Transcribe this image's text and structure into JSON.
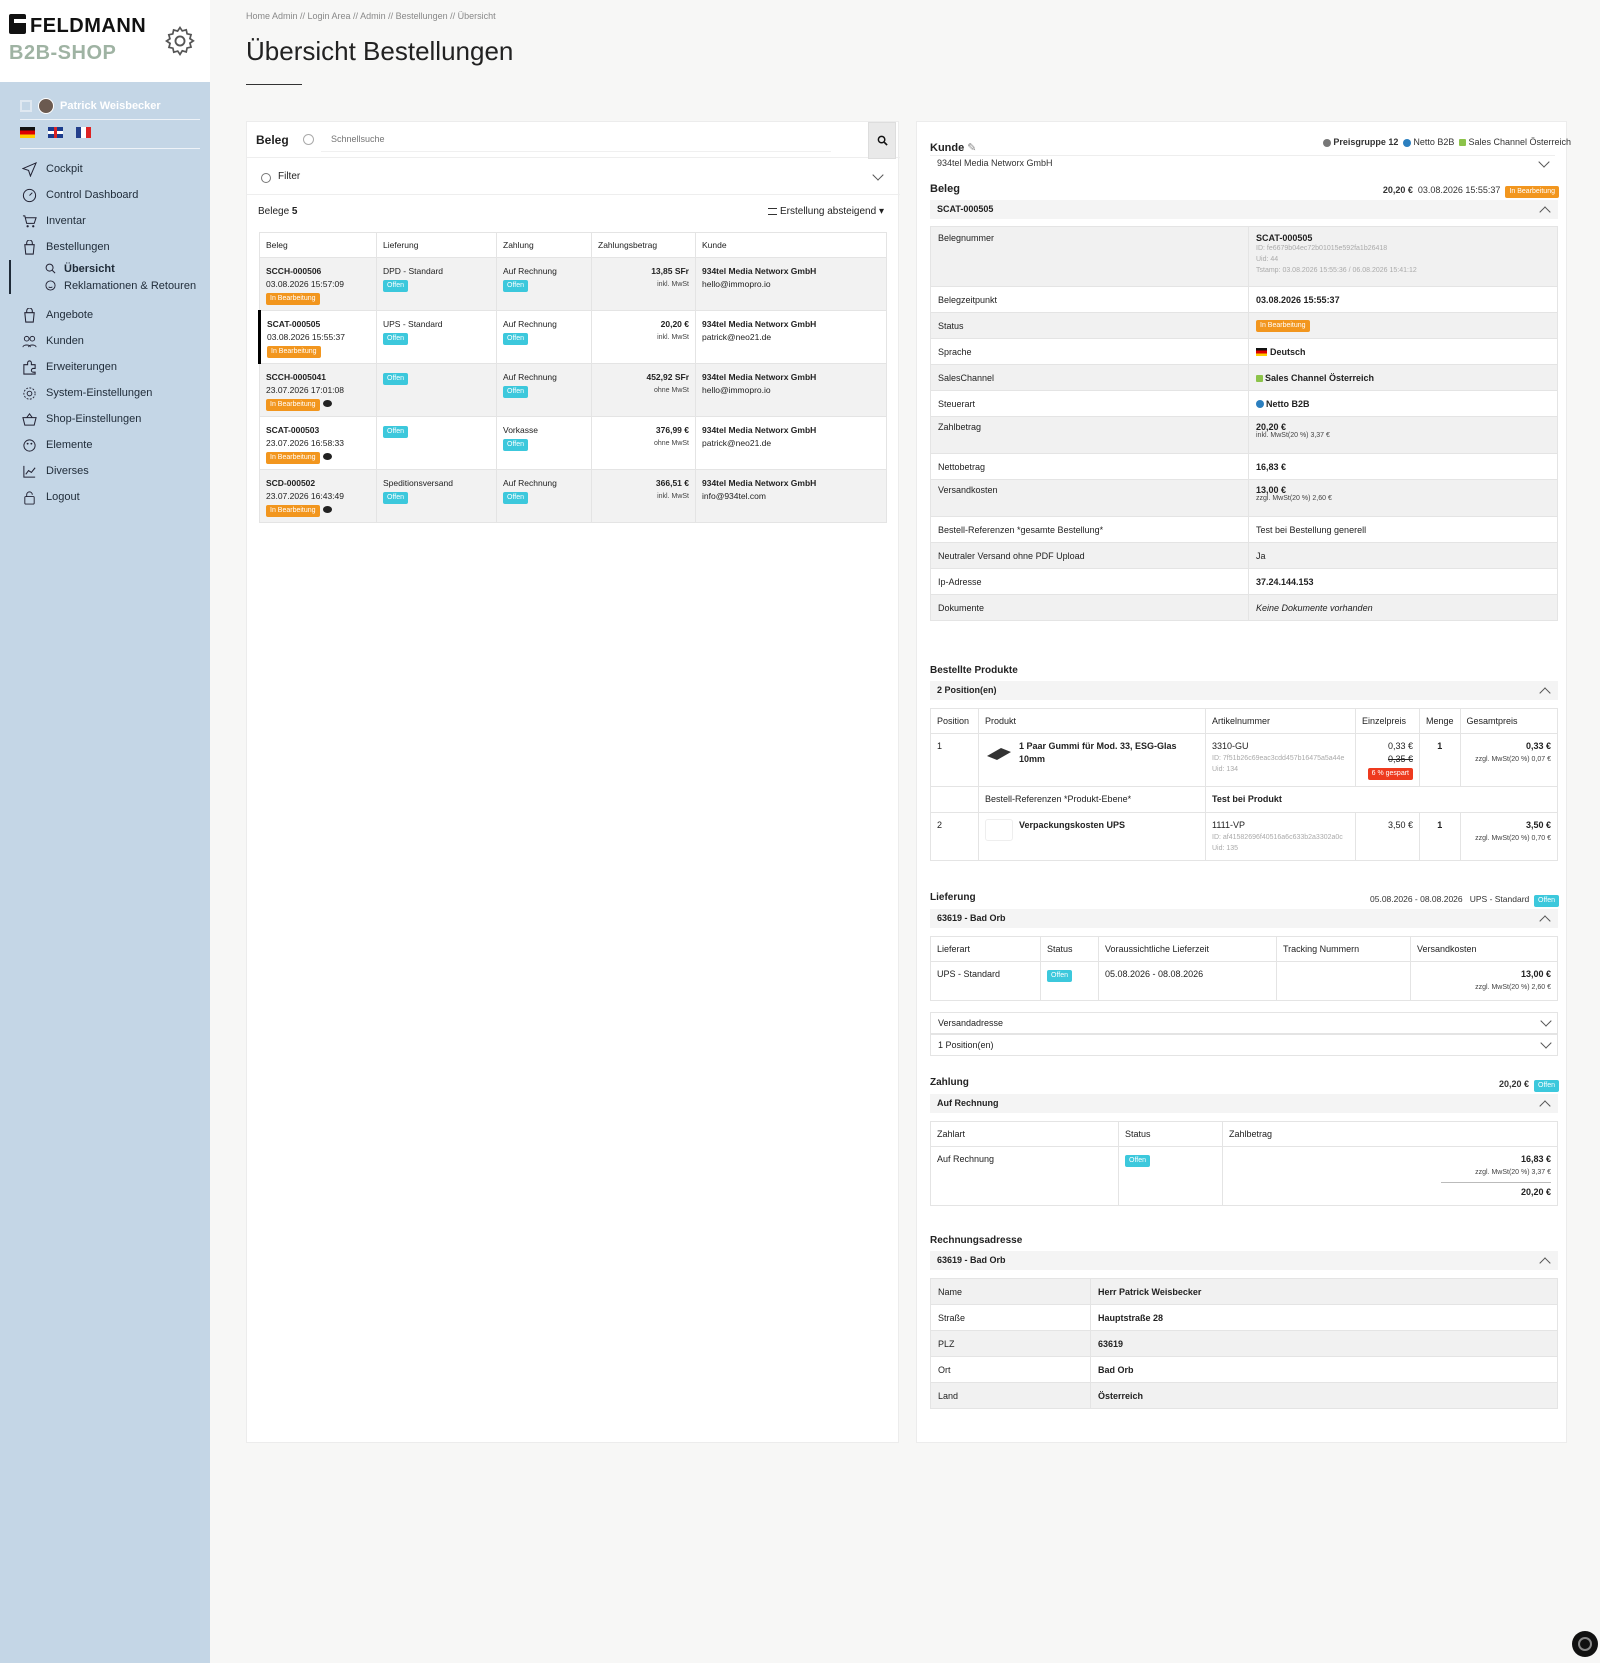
{
  "brand": {
    "line1": "FELDMANN",
    "line2": "B2B-SHOP"
  },
  "user": {
    "name": "Patrick Weisbecker"
  },
  "nav": [
    {
      "label": "Cockpit",
      "icon": "send-icon"
    },
    {
      "label": "Control Dashboard",
      "icon": "dashboard-icon"
    },
    {
      "label": "Inventar",
      "icon": "cart-icon"
    },
    {
      "label": "Bestellungen",
      "icon": "bag-icon"
    },
    {
      "label": "Übersicht",
      "icon": "search-icon"
    },
    {
      "label": "Reklamationen & Retouren",
      "icon": "smile-icon"
    },
    {
      "label": "Angebote",
      "icon": "bag-icon"
    },
    {
      "label": "Kunden",
      "icon": "users-icon"
    },
    {
      "label": "Erweiterungen",
      "icon": "puzzle-icon"
    },
    {
      "label": "System-Einstellungen",
      "icon": "gear-icon"
    },
    {
      "label": "Shop-Einstellungen",
      "icon": "basket-icon"
    },
    {
      "label": "Elemente",
      "icon": "palette-icon"
    },
    {
      "label": "Diverses",
      "icon": "chart-icon"
    },
    {
      "label": "Logout",
      "icon": "lock-icon"
    }
  ],
  "breadcrumb": "Home Admin // Login Area // Admin // Bestellungen // Übersicht",
  "page_title": "Übersicht Bestellungen",
  "left": {
    "search_label": "Beleg",
    "search_placeholder": "Schnellsuche",
    "filter_label": "Filter",
    "count_label": "Belege",
    "count": "5",
    "sort_label": "Erstellung absteigend",
    "columns": [
      "Beleg",
      "Lieferung",
      "Zahlung",
      "Zahlungsbetrag",
      "Kunde"
    ],
    "rows": [
      {
        "id": "SCCH-000506",
        "date": "03.08.2026 15:57:09",
        "status": "In Bearbeitung",
        "delivery": "DPD - Standard",
        "delivery_status": "Offen",
        "payment": "Auf Rechnung",
        "payment_status": "Offen",
        "amount": "13,85 SFr",
        "tax": "inkl. MwSt",
        "customer": "934tel Media Networx GmbH",
        "email": "hello@immopro.io",
        "comment": false
      },
      {
        "id": "SCAT-000505",
        "date": "03.08.2026 15:55:37",
        "status": "In Bearbeitung",
        "delivery": "UPS - Standard",
        "delivery_status": "Offen",
        "payment": "Auf Rechnung",
        "payment_status": "Offen",
        "amount": "20,20 €",
        "tax": "inkl. MwSt",
        "customer": "934tel Media Networx GmbH",
        "email": "patrick@neo21.de",
        "comment": false
      },
      {
        "id": "SCCH-0005041",
        "date": "23.07.2026 17:01:08",
        "status": "In Bearbeitung",
        "delivery": "",
        "delivery_status": "Offen",
        "payment": "Auf Rechnung",
        "payment_status": "Offen",
        "amount": "452,92 SFr",
        "tax": "ohne MwSt",
        "customer": "934tel Media Networx GmbH",
        "email": "hello@immopro.io",
        "comment": true
      },
      {
        "id": "SCAT-000503",
        "date": "23.07.2026 16:58:33",
        "status": "In Bearbeitung",
        "delivery": "",
        "delivery_status": "Offen",
        "payment": "Vorkasse",
        "payment_status": "Offen",
        "amount": "376,99 €",
        "tax": "ohne MwSt",
        "customer": "934tel Media Networx GmbH",
        "email": "patrick@neo21.de",
        "comment": true
      },
      {
        "id": "SCD-000502",
        "date": "23.07.2026 16:43:49",
        "status": "In Bearbeitung",
        "delivery": "Speditionsversand",
        "delivery_status": "Offen",
        "payment": "Auf Rechnung",
        "payment_status": "Offen",
        "amount": "366,51 €",
        "tax": "inkl. MwSt",
        "customer": "934tel Media Networx GmbH",
        "email": "info@934tel.com",
        "comment": true
      }
    ]
  },
  "right": {
    "kunde_label": "Kunde",
    "preisgruppe": "Preisgruppe 12",
    "netto": "Netto B2B",
    "channel": "Sales Channel Österreich",
    "customer": "934tel Media Networx GmbH",
    "beleg_label": "Beleg",
    "beleg_amount": "20,20 €",
    "beleg_date": "03.08.2026 15:55:37",
    "beleg_status": "In Bearbeitung",
    "beleg_id": "SCAT-000505",
    "belegnummer_label": "Belegnummer",
    "belegnummer": "SCAT-000505",
    "belegnummer_id": "ID: fe6679b04ec72b01015e592fa1b26418",
    "belegnummer_uid": "Uid: 44",
    "belegnummer_ts": "Tstamp: 03.08.2026 15:55:36 / 06.08.2026 15:41:12",
    "kv": [
      {
        "k": "Belegzeitpunkt",
        "v": "03.08.2026 15:55:37",
        "bold": true
      },
      {
        "k": "Status",
        "v": "In Bearbeitung",
        "badge": true
      },
      {
        "k": "Sprache",
        "v": "Deutsch",
        "bold": true,
        "icon": "de"
      },
      {
        "k": "SalesChannel",
        "v": "Sales Channel Österreich",
        "bold": true,
        "icon": "lock"
      },
      {
        "k": "Steuerart",
        "v": "Netto B2B",
        "bold": true,
        "icon": "globe"
      },
      {
        "k": "Zahlbetrag",
        "v": "20,20 €",
        "bold": true,
        "sub": "inkl. MwSt(20 %) 3,37 €"
      },
      {
        "k": "Nettobetrag",
        "v": "16,83 €",
        "bold": true
      },
      {
        "k": "Versandkosten",
        "v": "13,00 €",
        "bold": true,
        "sub": "zzgl. MwSt(20 %) 2,60 €"
      },
      {
        "k": "Bestell-Referenzen *gesamte Bestellung*",
        "v": "Test bei Bestellung generell"
      },
      {
        "k": "Neutraler Versand ohne PDF Upload",
        "v": "Ja"
      },
      {
        "k": "Ip-Adresse",
        "v": "37.24.144.153",
        "bold": true
      },
      {
        "k": "Dokumente",
        "v": "Keine Dokumente vorhanden",
        "italic": true
      }
    ],
    "products_label": "Bestellte Produkte",
    "products_count": "2 Position(en)",
    "product_columns": [
      "Position",
      "Produkt",
      "Artikelnummer",
      "Einzelpreis",
      "Menge",
      "Gesamtpreis"
    ],
    "products": [
      {
        "pos": "1",
        "name": "1 Paar Gummi für Mod. 33, ESG-Glas 10mm",
        "sku": "3310-GU",
        "sku_id": "ID: 7f51b26c69eac3cdd457b16475a5a44e",
        "sku_uid": "Uid: 134",
        "price": "0,33 €",
        "old_price": "0,35 €",
        "saving": "6 % gespart",
        "qty": "1",
        "total": "0,33 €",
        "total_tax": "zzgl. MwSt(20 %) 0,07 €"
      },
      {
        "pos": "2",
        "name": "Verpackungskosten UPS",
        "sku": "1111-VP",
        "sku_id": "ID: af41582696f40516a6c633b2a3302a0c",
        "sku_uid": "Uid: 135",
        "price": "3,50 €",
        "qty": "1",
        "total": "3,50 €",
        "total_tax": "zzgl. MwSt(20 %) 0,70 €"
      }
    ],
    "ref_label": "Bestell-Referenzen *Produkt-Ebene*",
    "ref_value": "Test bei Produkt",
    "delivery_label": "Lieferung",
    "delivery_range": "05.08.2026 - 08.08.2026",
    "delivery_method": "UPS - Standard",
    "delivery_status": "Offen",
    "delivery_addr": "63619 - Bad Orb",
    "delivery_columns": [
      "Lieferart",
      "Status",
      "Voraussichtliche Lieferzeit",
      "Tracking Nummern",
      "Versandkosten"
    ],
    "delivery_row": {
      "method": "UPS - Standard",
      "status": "Offen",
      "time": "05.08.2026 - 08.08.2026",
      "tracking": "",
      "cost": "13,00 €",
      "cost_tax": "zzgl. MwSt(20 %) 2,60 €"
    },
    "versandadresse": "Versandadresse",
    "delivery_positions": "1 Position(en)",
    "payment_label": "Zahlung",
    "payment_amount": "20,20 €",
    "payment_status": "Offen",
    "payment_method": "Auf Rechnung",
    "payment_columns": [
      "Zahlart",
      "Status",
      "Zahlbetrag"
    ],
    "payment_row": {
      "method": "Auf Rechnung",
      "status": "Offen",
      "net": "16,83 €",
      "tax": "zzgl. MwSt(20 %) 3,37 €",
      "total": "20,20 €"
    },
    "billing_label": "Rechnungsadresse",
    "billing_addr": "63619 - Bad Orb",
    "billing": [
      {
        "k": "Name",
        "v": "Herr Patrick Weisbecker"
      },
      {
        "k": "Straße",
        "v": "Hauptstraße 28"
      },
      {
        "k": "PLZ",
        "v": "63619"
      },
      {
        "k": "Ort",
        "v": "Bad Orb"
      },
      {
        "k": "Land",
        "v": "Österreich"
      }
    ]
  },
  "colors": {
    "sidebar": "#c4d6e6",
    "badge_blue": "#3cc8dc",
    "badge_orange": "#f2961e",
    "badge_red": "#ee3a1e",
    "brand_green": "#9fb3a3"
  }
}
